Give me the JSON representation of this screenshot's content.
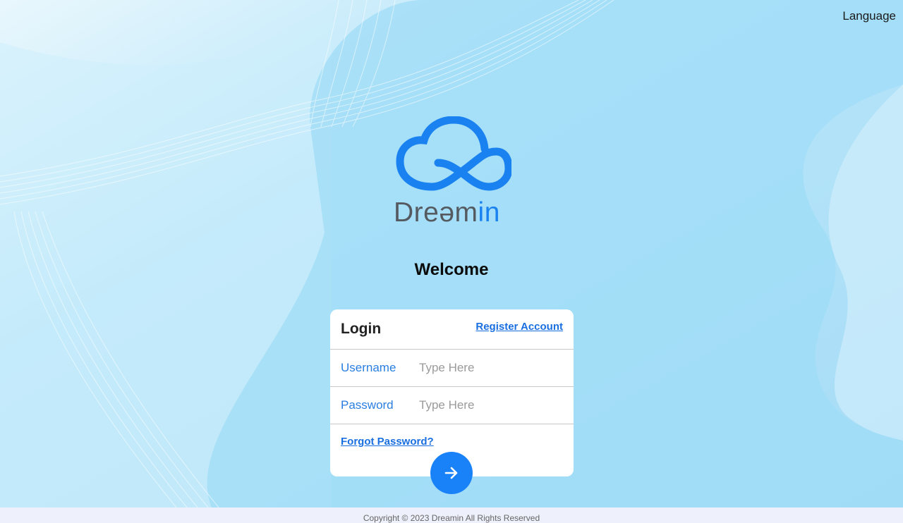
{
  "header": {
    "language_label": "Language"
  },
  "brand": {
    "name_part1": "Dreəm",
    "name_part2": "in",
    "primary_color": "#1a82f0",
    "text_color": "#555a60"
  },
  "welcome_text": "Welcome",
  "login_card": {
    "title": "Login",
    "register_label": "Register Account",
    "username_label": "Username",
    "username_placeholder": "Type Here",
    "password_label": "Password",
    "password_placeholder": "Type Here",
    "forgot_label": "Forgot Password?",
    "submit_icon": "arrow-right-icon"
  },
  "footer": {
    "copyright": "Copyright © 2023 Dreamin All Rights Reserved"
  }
}
